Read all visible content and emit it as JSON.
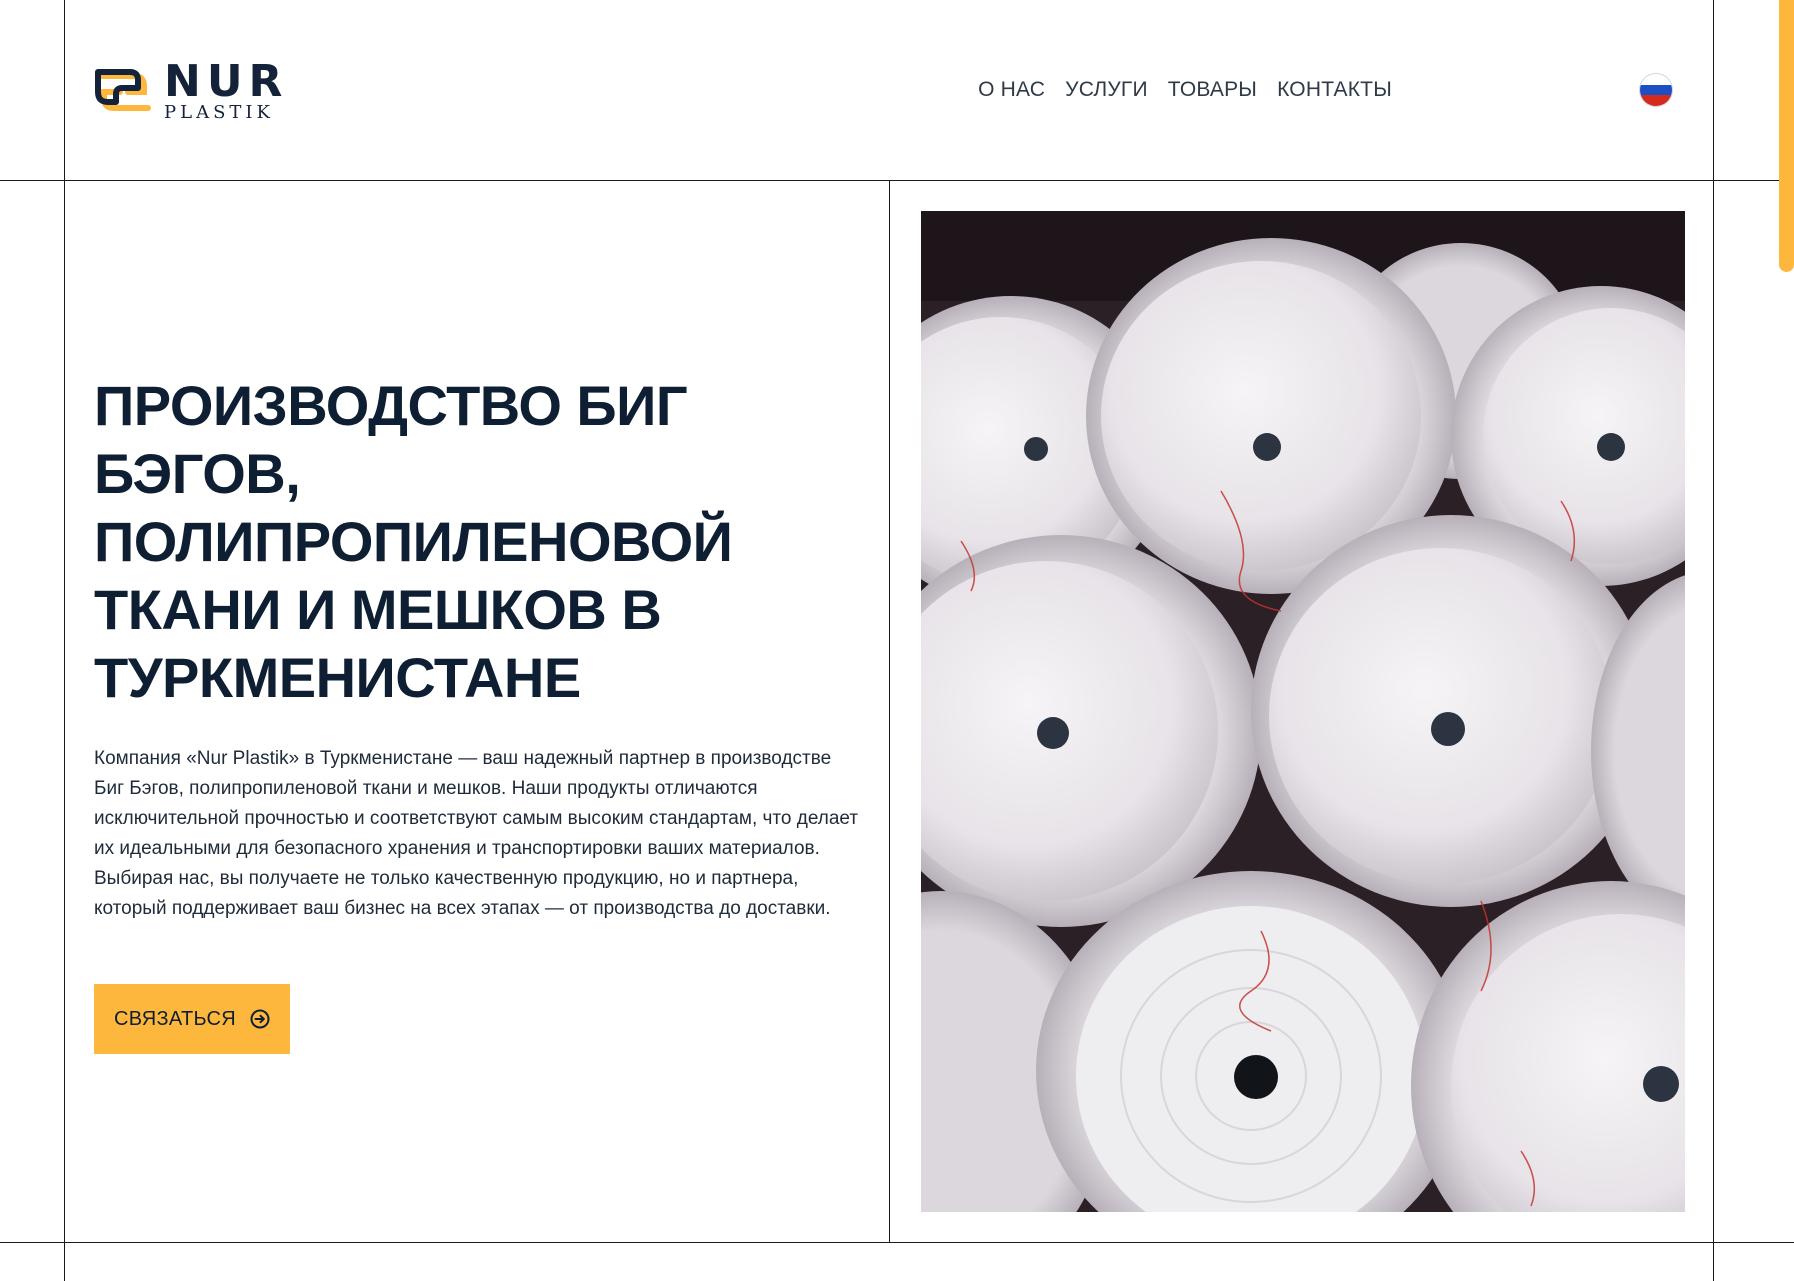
{
  "brand": {
    "name": "NUR",
    "subname": "PLASTIK",
    "logo_icon": "logo-mark-icon",
    "accent_color": "#fdb73d",
    "dark_color": "#14233a"
  },
  "nav": {
    "items": [
      {
        "label": "О НАС"
      },
      {
        "label": "УСЛУГИ"
      },
      {
        "label": "ТОВАРЫ"
      },
      {
        "label": "КОНТАКТЫ"
      }
    ],
    "language_icon": "russian-flag-icon"
  },
  "hero": {
    "title": "Производство Биг Бэгов, полипропиленовой ткани и мешков в Туркменистане",
    "description": "Компания «Nur Plastik» в Туркменистане — ваш надежный партнер в производстве Биг Бэгов, полипропиленовой ткани и мешков. Наши продукты отличаются исключительной прочностью и соответствуют самым высоким стандартам, что делает их идеальными для безопасного хранения и транспортировки ваших материалов. Выбирая нас, вы получаете не только качественную продукцию, но и партнера, который поддерживает ваш бизнес на всех этапах — от производства до доставки.",
    "cta_label": "СВЯЗАТЬСЯ",
    "cta_icon": "arrow-right-circle-icon",
    "image": "polypropylene-fabric-rolls-photo"
  }
}
